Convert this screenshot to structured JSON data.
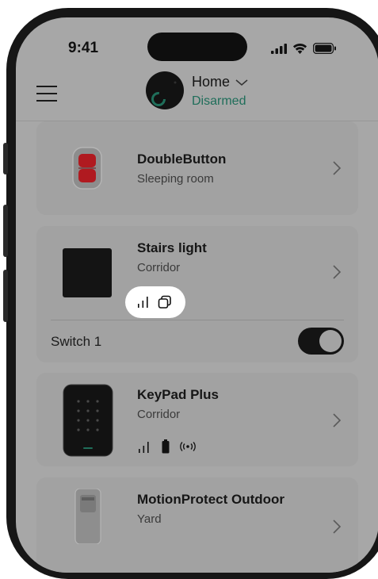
{
  "status_bar": {
    "time": "9:41"
  },
  "header": {
    "hub_name": "Home",
    "hub_status": "Disarmed"
  },
  "devices": [
    {
      "name": "DoubleButton",
      "room": "Sleeping room"
    },
    {
      "name": "Stairs light",
      "room": "Corridor",
      "switch_label": "Switch 1",
      "switch_on": true
    },
    {
      "name": "KeyPad Plus",
      "room": "Corridor"
    },
    {
      "name": "MotionProtect Outdoor",
      "room": "Yard"
    }
  ],
  "colors": {
    "status_green": "#1f6e5a",
    "background_overlay": "#a7a7a7",
    "highlight_pill": "#ffffff"
  }
}
